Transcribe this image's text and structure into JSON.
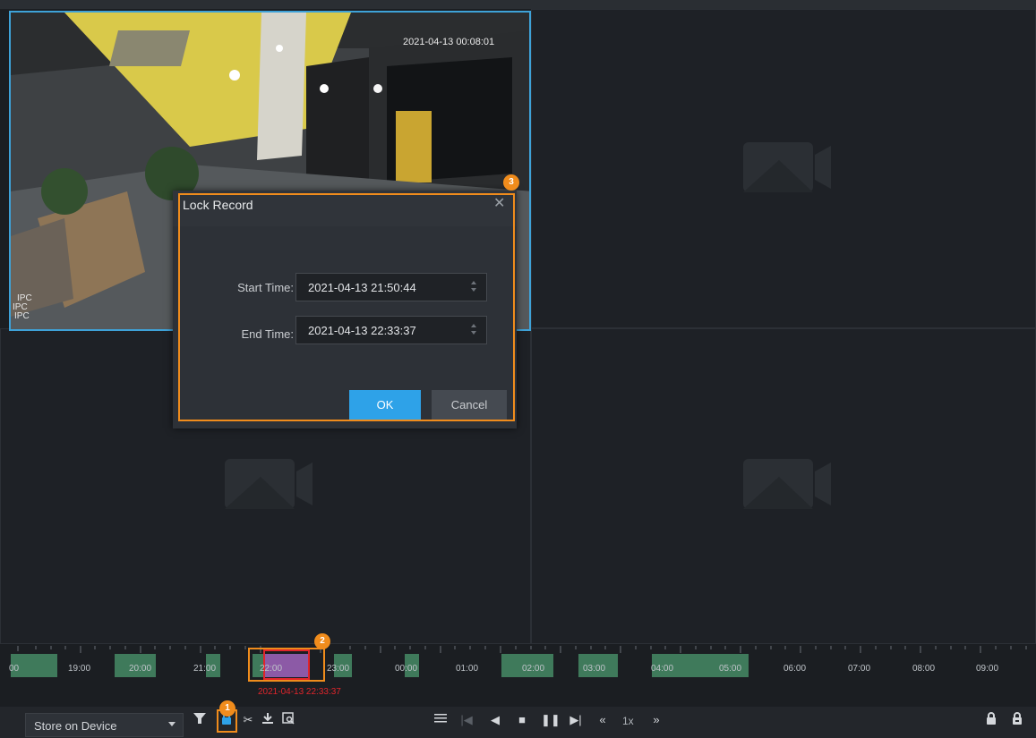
{
  "video": {
    "timestamp": "2021-04-13 00:08:01",
    "channel_labels": [
      "IPC",
      "IPC",
      "IPC"
    ]
  },
  "dialog": {
    "title": "Lock Record",
    "start_label": "Start Time:",
    "start_value": "2021-04-13 21:50:44",
    "end_label": "End Time:",
    "end_value": "2021-04-13 22:33:37",
    "ok_label": "OK",
    "cancel_label": "Cancel"
  },
  "timeline": {
    "labels": [
      "19:00",
      "20:00",
      "21:00",
      "22:00",
      "23:00",
      "00:00",
      "01:00",
      "02:00",
      "03:00",
      "04:00",
      "05:00",
      "06:00",
      "07:00",
      "08:00",
      "09:00"
    ],
    "leading_label": "00",
    "cursor_time": "2021-04-13 22:33:37"
  },
  "toolbar": {
    "storage_select": "Store on Device",
    "speed": "1x",
    "icons": [
      "filter-icon",
      "lock-icon",
      "scissors-icon",
      "download-icon",
      "search-record-icon",
      "align-icon",
      "prev-frame-icon",
      "play-reverse-icon",
      "stop-icon",
      "pause-icon",
      "next-frame-icon",
      "slow-icon",
      "fast-icon",
      "lock-list-icon",
      "lock-all-icon"
    ]
  },
  "callouts": [
    "1",
    "2",
    "3"
  ],
  "colors": {
    "accent": "#2ea2e8",
    "callout": "#f08c1c",
    "record_segment": "#3f7a5b",
    "locked_segment": "#8c5aa6",
    "cursor_time": "#e0252b"
  }
}
